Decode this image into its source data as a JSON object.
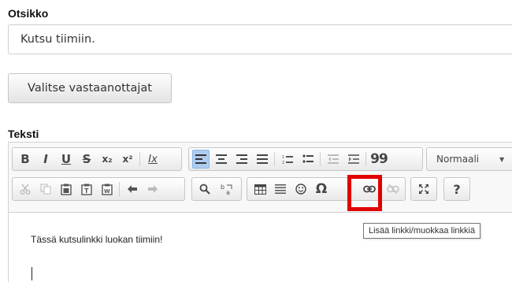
{
  "form": {
    "title_label": "Otsikko",
    "title_value": "Kutsu tiimiin.",
    "recipients_button": "Valitse vastaanottajat",
    "text_label": "Teksti"
  },
  "editor": {
    "format_select": "Normaali",
    "content_text": "Tässä kutsulinkki luokan tiimiin!",
    "tooltip": "Lisää linkki/muokkaa linkkiä",
    "toolbar": {
      "bold": "B",
      "italic": "I",
      "underline": "U",
      "strike": "S",
      "subscript": "x₂",
      "superscript": "x²",
      "remove_format": "Ix",
      "blockquote": "99",
      "special_char": "Ω",
      "help": "?"
    }
  },
  "colors": {
    "highlight": "#e00000",
    "active_button": "#aeccef"
  }
}
